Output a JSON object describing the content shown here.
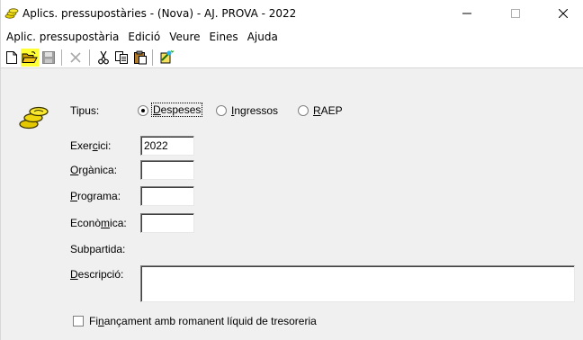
{
  "window": {
    "title": "Aplics. pressupostàries - (Nova) - AJ. PROVA - 2022",
    "minimize_glyph": "—",
    "maximize_glyph": "☐",
    "close_glyph": "✕"
  },
  "menu": [
    {
      "label": "Aplic. pressupostària"
    },
    {
      "label": "Edició"
    },
    {
      "label": "Veure"
    },
    {
      "label": "Eines"
    },
    {
      "label": "Ajuda"
    }
  ],
  "toolbar": {
    "icons": [
      "new-document-icon",
      "open-folder-icon",
      "save-icon",
      "delete-icon",
      "cut-icon",
      "copy-icon",
      "paste-icon",
      "wizard-icon"
    ],
    "highlight_color": "#ffff33"
  },
  "form": {
    "tipus_label": "Tipus:",
    "tipus_options": [
      {
        "pre": "",
        "u": "D",
        "post": "espeses",
        "selected": true
      },
      {
        "pre": "",
        "u": "I",
        "post": "ngressos",
        "selected": false
      },
      {
        "pre": "",
        "u": "R",
        "post": "AEP",
        "selected": false
      }
    ],
    "exercici": {
      "label_pre": "Exer",
      "label_u": "c",
      "label_post": "ici:",
      "value": "2022"
    },
    "organica": {
      "label_pre": "",
      "label_u": "O",
      "label_post": "rgànica:",
      "value": ""
    },
    "programa": {
      "label_pre": "",
      "label_u": "P",
      "label_post": "rograma:",
      "value": ""
    },
    "economica": {
      "label_pre": "Econò",
      "label_u": "m",
      "label_post": "ica:",
      "value": ""
    },
    "subpartida": {
      "label": "Subpartida:"
    },
    "descripcio": {
      "label_pre": "",
      "label_u": "D",
      "label_post": "escripció:",
      "value": ""
    },
    "financament": {
      "label_pre": "Fi",
      "label_u": "n",
      "label_post": "ançament amb romanent líquid de tresoreria",
      "checked": false
    }
  }
}
